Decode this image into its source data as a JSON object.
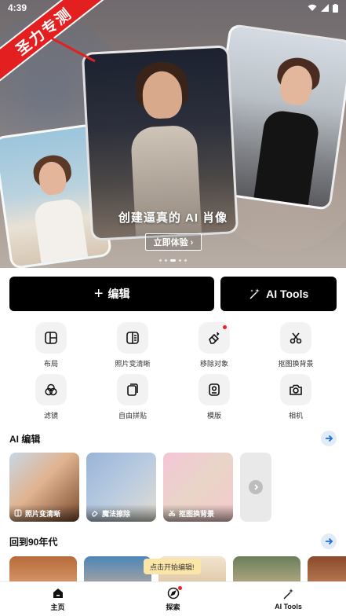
{
  "status_bar": {
    "time": "4:39"
  },
  "ribbon": {
    "text": "圣力专测"
  },
  "hero": {
    "title": "创建逼真的 AI 肖像",
    "cta": "立即体验 ›",
    "dots": 5,
    "active_dot": 2
  },
  "actions": {
    "edit_label": "编辑",
    "ai_tools_label": "AI Tools"
  },
  "tools": [
    {
      "label": "布局",
      "icon": "layout-icon"
    },
    {
      "label": "照片变清晰",
      "icon": "enhance-icon"
    },
    {
      "label": "移除对象",
      "icon": "eraser-icon",
      "badge": true
    },
    {
      "label": "抠图换背景",
      "icon": "scissors-icon"
    },
    {
      "label": "滤镜",
      "icon": "filter-icon"
    },
    {
      "label": "自由拼贴",
      "icon": "collage-icon"
    },
    {
      "label": "模版",
      "icon": "template-icon"
    },
    {
      "label": "相机",
      "icon": "camera-icon"
    }
  ],
  "ai_edit": {
    "title": "AI 编辑",
    "cards": [
      {
        "label": "照片变清晰",
        "icon": "enhance-icon"
      },
      {
        "label": "魔法擦除",
        "icon": "eraser-icon"
      },
      {
        "label": "抠图换背景",
        "icon": "scissors-icon"
      }
    ]
  },
  "retro": {
    "title": "回到90年代",
    "tooltip": "点击开始编辑!"
  },
  "nav": {
    "home": "主页",
    "explore": "探索",
    "ai_tools": "AI Tools"
  },
  "colors": {
    "primary": "#000000",
    "accent_blue": "#1e6fd9",
    "badge_red": "#e22222",
    "ribbon_red": "#e41f1f"
  }
}
